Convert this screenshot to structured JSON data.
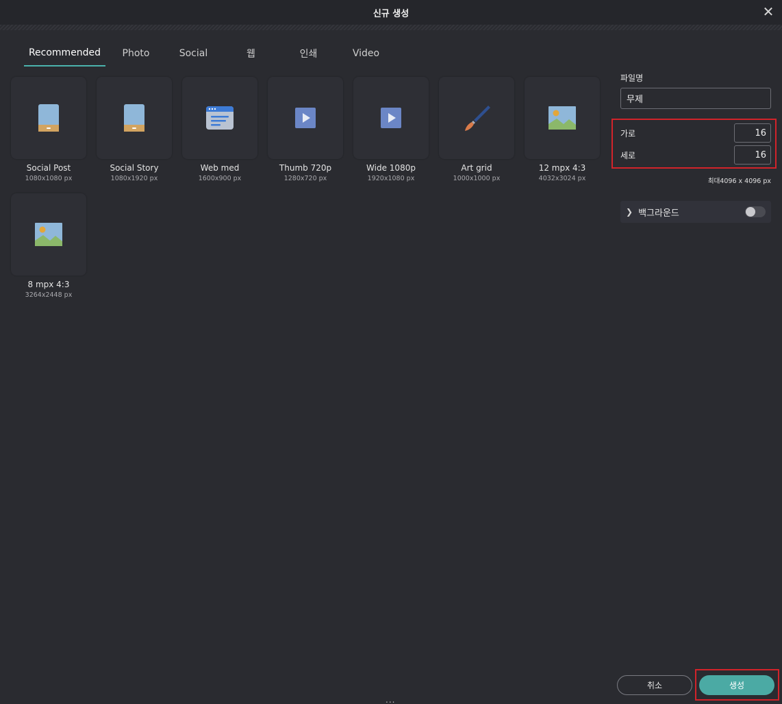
{
  "window": {
    "title": "신규 생성",
    "close_icon": "close-icon"
  },
  "tabs": [
    {
      "label": "Recommended",
      "active": true
    },
    {
      "label": "Photo"
    },
    {
      "label": "Social"
    },
    {
      "label": "웹"
    },
    {
      "label": "인쇄"
    },
    {
      "label": "Video"
    }
  ],
  "presets": [
    {
      "name": "Social Post",
      "size": "1080x1080 px",
      "icon": "phone-icon"
    },
    {
      "name": "Social Story",
      "size": "1080x1920 px",
      "icon": "phone-icon"
    },
    {
      "name": "Web med",
      "size": "1600x900 px",
      "icon": "browser-icon"
    },
    {
      "name": "Thumb 720p",
      "size": "1280x720 px",
      "icon": "video-play-icon"
    },
    {
      "name": "Wide 1080p",
      "size": "1920x1080 px",
      "icon": "video-play-icon"
    },
    {
      "name": "Art grid",
      "size": "1000x1000 px",
      "icon": "brush-icon"
    },
    {
      "name": "12 mpx 4:3",
      "size": "4032x3024 px",
      "icon": "landscape-photo-icon"
    },
    {
      "name": "8 mpx 4:3",
      "size": "3264x2448 px",
      "icon": "landscape-photo-icon"
    }
  ],
  "panel": {
    "filename_label": "파일명",
    "filename_value": "무제",
    "width_label": "가로",
    "width_value": "16",
    "height_label": "세로",
    "height_value": "16",
    "max_text": "최대4096 x 4096 px",
    "background_label": "백그라운드",
    "background_enabled": false
  },
  "buttons": {
    "cancel": "취소",
    "create": "생성"
  },
  "footer": {
    "more": "..."
  },
  "colors": {
    "accent": "#4baaa4",
    "highlight": "#d2232a",
    "background": "#2a2b30"
  }
}
